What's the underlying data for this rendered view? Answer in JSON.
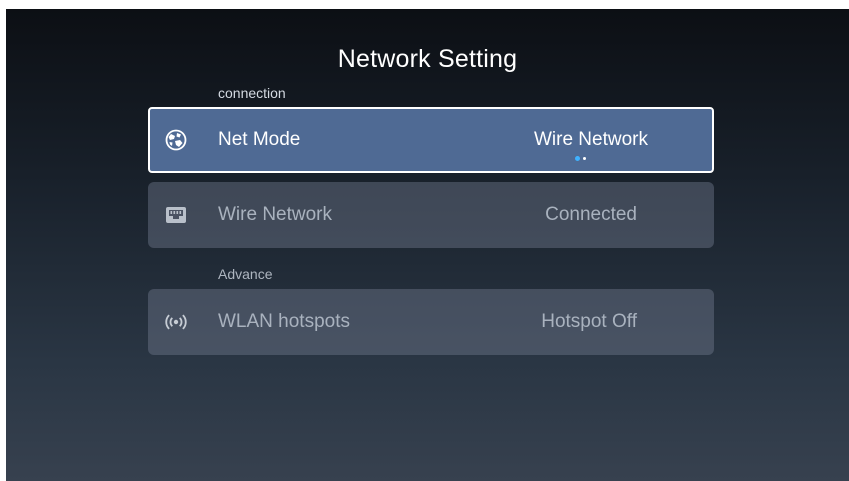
{
  "page": {
    "title": "Network Setting"
  },
  "sections": {
    "connection_label": "connection",
    "advance_label": "Advance"
  },
  "rows": [
    {
      "icon": "globe-icon",
      "label": "Net Mode",
      "value": "Wire Network",
      "focused": true
    },
    {
      "icon": "ethernet-port-icon",
      "label": "Wire Network",
      "value": "Connected",
      "focused": false
    },
    {
      "icon": "hotspot-signal-icon",
      "label": "WLAN hotspots",
      "value": "Hotspot Off",
      "focused": false
    }
  ],
  "colors": {
    "focused_row": "#4f6a94",
    "row": "#4a5262",
    "accent_dot": "#3fb2ff"
  }
}
